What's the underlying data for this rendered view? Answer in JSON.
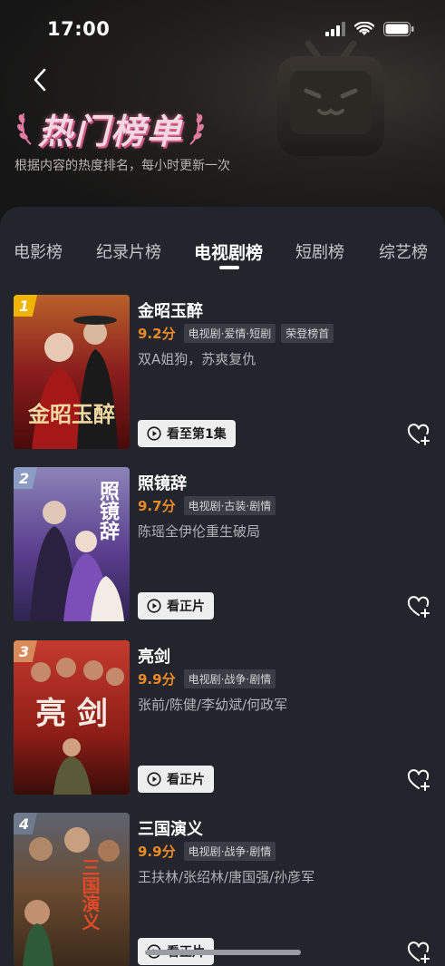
{
  "status_bar": {
    "time": "17:00"
  },
  "header": {
    "title": "热门榜单",
    "subtitle": "根据内容的热度排名，每小时更新一次"
  },
  "tabs": [
    {
      "label": "电影榜",
      "active": false
    },
    {
      "label": "纪录片榜",
      "active": false
    },
    {
      "label": "电视剧榜",
      "active": true
    },
    {
      "label": "短剧榜",
      "active": false
    },
    {
      "label": "综艺榜",
      "active": false
    }
  ],
  "items": [
    {
      "rank": "1",
      "title": "金昭玉醉",
      "score": "9.2分",
      "tags": [
        "电视剧·爱情·短剧",
        "荣登榜首"
      ],
      "desc": "双A姐狗，苏爽复仇",
      "button": "看至第1集",
      "badge_color": "#f0b400",
      "poster_text": "金昭玉醉"
    },
    {
      "rank": "2",
      "title": "照镜辞",
      "score": "9.7分",
      "tags": [
        "电视剧·古装·剧情"
      ],
      "desc": "陈瑶全伊伦重生破局",
      "button": "看正片",
      "badge_color": "#8a9bc4",
      "poster_text": "照镜辞"
    },
    {
      "rank": "3",
      "title": "亮剑",
      "score": "9.9分",
      "tags": [
        "电视剧·战争·剧情"
      ],
      "desc": "张前/陈健/李幼斌/何政军",
      "button": "看正片",
      "badge_color": "#d98a5a",
      "poster_text": "亮 剑"
    },
    {
      "rank": "4",
      "title": "三国演义",
      "score": "9.9分",
      "tags": [
        "电视剧·战争·剧情"
      ],
      "desc": "王扶林/张绍林/唐国强/孙彦军",
      "button": "看正片",
      "badge_color": "#6f7a8c",
      "poster_text": "三国演义"
    }
  ],
  "colors": {
    "accent_score": "#f08a22",
    "background": "#22252b"
  },
  "icons": [
    "back-icon",
    "signal-icon",
    "wifi-icon",
    "battery-icon",
    "play-circle-icon",
    "heart-plus-icon"
  ]
}
